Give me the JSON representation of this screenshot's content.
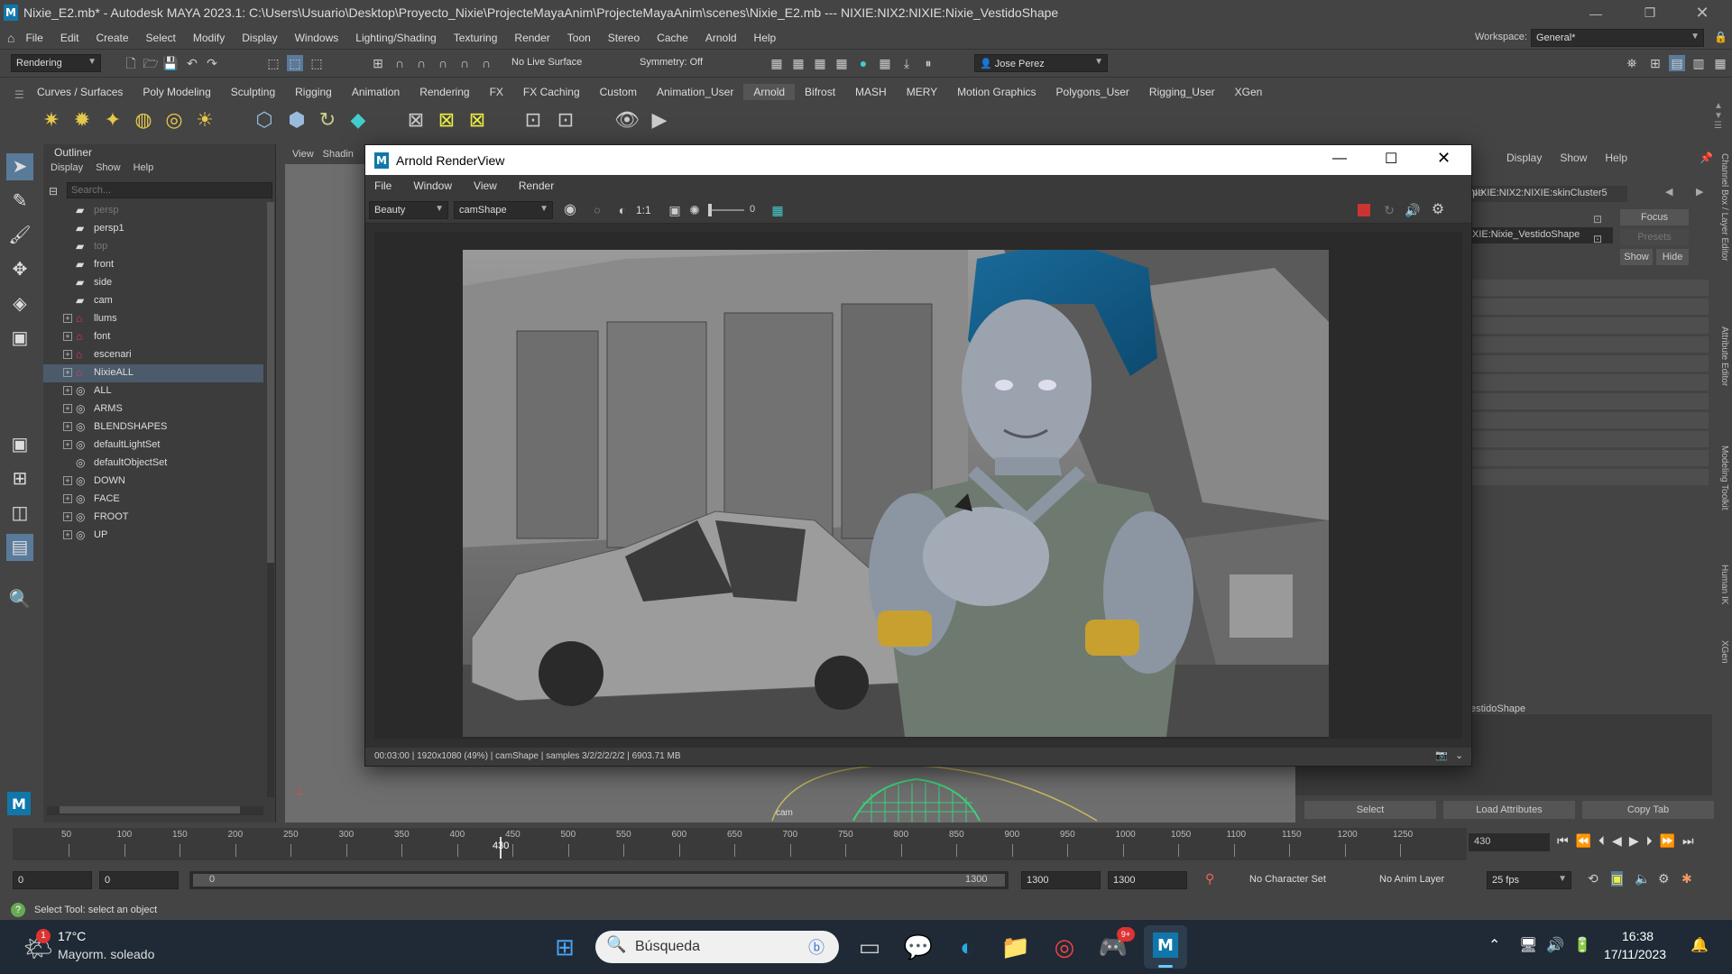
{
  "window": {
    "title": "Nixie_E2.mb* - Autodesk MAYA 2023.1: C:\\Users\\Usuario\\Desktop\\Proyecto_Nixie\\ProjecteMayaAnim\\ProjecteMayaAnim\\scenes\\Nixie_E2.mb   ---   NIXIE:NIX2:NIXIE:Nixie_VestidoShape",
    "logo": "M"
  },
  "menubar": {
    "items": [
      "File",
      "Edit",
      "Create",
      "Select",
      "Modify",
      "Display",
      "Windows",
      "Lighting/Shading",
      "Texturing",
      "Render",
      "Toon",
      "Stereo",
      "Cache",
      "Arnold",
      "Help"
    ],
    "workspace_label": "Workspace:",
    "workspace_value": "General*"
  },
  "statusline": {
    "menuset": "Rendering",
    "live_surface": "No Live Surface",
    "symmetry": "Symmetry: Off",
    "user": "Jose Perez"
  },
  "shelf": {
    "tabs": [
      "Curves / Surfaces",
      "Poly Modeling",
      "Sculpting",
      "Rigging",
      "Animation",
      "Rendering",
      "FX",
      "FX Caching",
      "Custom",
      "Animation_User",
      "Arnold",
      "Bifrost",
      "MASH",
      "MERY",
      "Motion Graphics",
      "Polygons_User",
      "Rigging_User",
      "XGen"
    ],
    "active_tab": "Arnold"
  },
  "outliner": {
    "title": "Outliner",
    "menu": [
      "Display",
      "Show",
      "Help"
    ],
    "search_placeholder": "Search...",
    "items": [
      {
        "label": "persp",
        "icon": "camera-icon",
        "expand": false,
        "dim": true
      },
      {
        "label": "persp1",
        "icon": "camera-icon",
        "expand": false,
        "dim": false
      },
      {
        "label": "top",
        "icon": "camera-icon",
        "expand": false,
        "dim": true
      },
      {
        "label": "front",
        "icon": "camera-icon",
        "expand": false,
        "dim": false
      },
      {
        "label": "side",
        "icon": "camera-icon",
        "expand": false,
        "dim": false
      },
      {
        "label": "cam",
        "icon": "camera-icon",
        "expand": false,
        "dim": false
      },
      {
        "label": "llums",
        "icon": "group-icon",
        "expand": true,
        "dim": false
      },
      {
        "label": "font",
        "icon": "group-icon",
        "expand": true,
        "dim": false
      },
      {
        "label": "escenari",
        "icon": "group-icon",
        "expand": true,
        "dim": false
      },
      {
        "label": "NixieALL",
        "icon": "group-icon",
        "expand": true,
        "dim": false,
        "selected": true
      },
      {
        "label": "ALL",
        "icon": "set-icon",
        "expand": true,
        "dim": false
      },
      {
        "label": "ARMS",
        "icon": "set-icon",
        "expand": true,
        "dim": false
      },
      {
        "label": "BLENDSHAPES",
        "icon": "set-icon",
        "expand": true,
        "dim": false
      },
      {
        "label": "defaultLightSet",
        "icon": "set-icon",
        "expand": true,
        "dim": false
      },
      {
        "label": "defaultObjectSet",
        "icon": "set-icon",
        "expand": false,
        "dim": false
      },
      {
        "label": "DOWN",
        "icon": "set-icon",
        "expand": true,
        "dim": false
      },
      {
        "label": "FACE",
        "icon": "set-icon",
        "expand": true,
        "dim": false
      },
      {
        "label": "FROOT",
        "icon": "set-icon",
        "expand": true,
        "dim": false
      },
      {
        "label": "UP",
        "icon": "set-icon",
        "expand": true,
        "dim": false
      }
    ]
  },
  "viewport": {
    "menu": [
      "View",
      "Shadin"
    ],
    "camera_label": "cam"
  },
  "renderview": {
    "title": "Arnold RenderView",
    "menu": [
      "File",
      "Window",
      "View",
      "Render"
    ],
    "aov": "Beauty",
    "camera": "camShape",
    "ratio": "1:1",
    "exposure": "0",
    "status": "00:03:00 | 1920x1080 (49%) | camShape  | samples 3/2/2/2/2/2 | 6903.71 MB"
  },
  "attribute_panel": {
    "menu": [
      "Display",
      "Show",
      "Help"
    ],
    "tab_left": "hape",
    "tab": "NIXIE:NIX2:NIXIE:skinCluster5",
    "node_field": "XIE:Nixie_VestidoShape",
    "focus": "Focus",
    "presets": "Presets",
    "show": "Show",
    "hide": "Hide",
    "shape_label": "estidoShape",
    "buttons": [
      "Select",
      "Load Attributes",
      "Copy Tab"
    ],
    "side_tabs": [
      "Channel Box / Layer Editor",
      "Attribute Editor",
      "Modeling Toolkit",
      "Human IK",
      "XGen"
    ]
  },
  "timeslider": {
    "ticks": [
      "50",
      "100",
      "150",
      "200",
      "250",
      "300",
      "350",
      "400",
      "450",
      "500",
      "550",
      "600",
      "650",
      "700",
      "750",
      "800",
      "850",
      "900",
      "950",
      "1000",
      "1050",
      "1100",
      "1150",
      "1200",
      "1250"
    ],
    "current": "430",
    "current_field": "430"
  },
  "rangeslider": {
    "start": "0",
    "anim_start": "0",
    "range_start": "0",
    "range_end": "1300",
    "end1": "1300",
    "end2": "1300",
    "character_set": "No Character Set",
    "anim_layer": "No Anim Layer",
    "fps": "25 fps"
  },
  "helpline": {
    "text": "Select Tool: select an object"
  },
  "taskbar": {
    "weather_temp": "17°C",
    "weather_desc": "Mayorm. soleado",
    "weather_badge": "1",
    "search_placeholder": "Búsqueda",
    "time": "16:38",
    "date": "17/11/2023",
    "discord_badge": "9+"
  }
}
